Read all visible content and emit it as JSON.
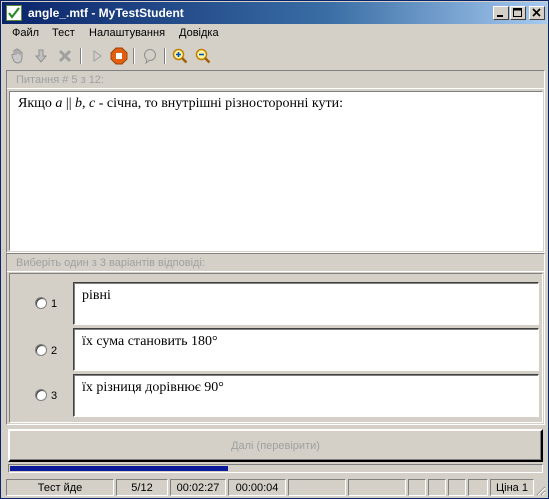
{
  "window": {
    "title": "angle_.mtf - MyTestStudent"
  },
  "menu": [
    "Файл",
    "Тест",
    "Налаштування",
    "Довідка"
  ],
  "toolbar": {
    "icons": [
      "hand-icon",
      "down-arrow-icon",
      "delete-icon",
      "play-icon",
      "stop-icon",
      "chat-icon",
      "zoom-in-icon",
      "zoom-out-icon"
    ]
  },
  "question": {
    "header": "Питання # 5 з 12:",
    "text_prefix": "Якщо ",
    "var_a": "a",
    "parallel": " || ",
    "var_b": "b",
    "comma": ", ",
    "var_c": "c",
    "text_suffix": " - січна, то внутрішні різносторонні кути:"
  },
  "answers": {
    "header": "Виберіть один з 3 варіантів відповіді:",
    "items": [
      {
        "number": "1",
        "text": "рівні"
      },
      {
        "number": "2",
        "text": "їх сума становить 180°"
      },
      {
        "number": "3",
        "text": "їх різниця дорівнює 90°"
      }
    ]
  },
  "next_button": "Далі (перевірити)",
  "progress": {
    "fraction": 0.41
  },
  "status": {
    "state": "Тест йде",
    "counter": "5/12",
    "elapsed": "00:02:27",
    "question_time": "00:00:04",
    "price": "Ціна 1"
  },
  "colors": {
    "title_start": "#0a246a",
    "title_end": "#a6caf0",
    "face": "#d4d0c8",
    "progress": "#0a1a9a",
    "stop_icon": "#e06010"
  }
}
